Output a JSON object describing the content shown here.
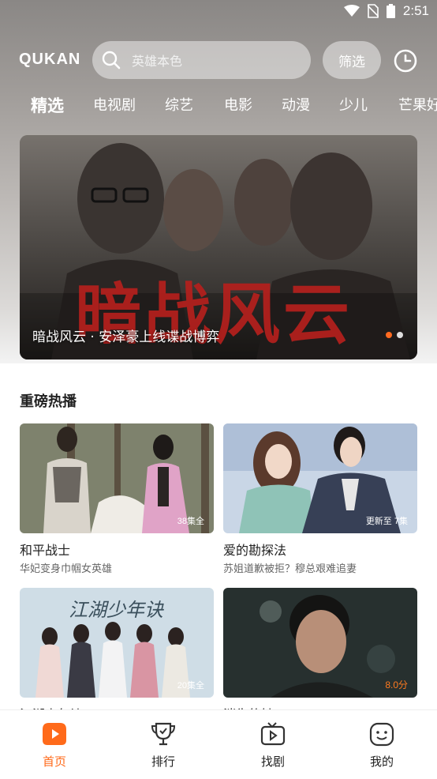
{
  "status_bar": {
    "time": "2:51"
  },
  "header": {
    "logo": "QUKAN",
    "search_placeholder": "英雄本色",
    "filter_label": "筛选"
  },
  "tabs": [
    "精选",
    "电视剧",
    "综艺",
    "电影",
    "动漫",
    "少儿",
    "芒果好"
  ],
  "banner": {
    "caption": "暗战风云 · 安泽豪上线谍战博弈",
    "poster_text": "暗战风云"
  },
  "section": {
    "title": "重磅热播",
    "cards": [
      {
        "title": "和平战士",
        "desc": "华妃变身巾帼女英雄",
        "badge": "38集全"
      },
      {
        "title": "爱的勘探法",
        "desc": "苏姐道歉被拒？穆总艰难追妻",
        "badge": "更新至 7集"
      },
      {
        "title": "江湖少年诀",
        "desc": "",
        "badge": "20集全",
        "poster_text": "江湖少年诀"
      },
      {
        "title": "消失的她",
        "desc": "",
        "badge": "8.0分"
      }
    ]
  },
  "bottom_nav": [
    {
      "label": "首页",
      "icon": "home-play-icon"
    },
    {
      "label": "排行",
      "icon": "trophy-icon"
    },
    {
      "label": "找剧",
      "icon": "tv-icon"
    },
    {
      "label": "我的",
      "icon": "smile-face-icon"
    }
  ],
  "colors": {
    "accent": "#ff6a1a"
  }
}
